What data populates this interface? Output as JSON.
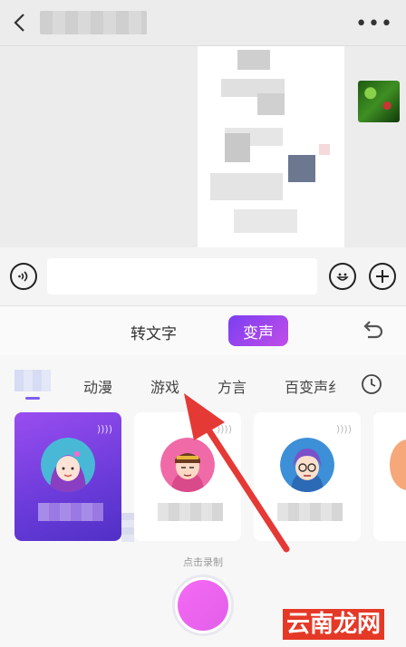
{
  "header": {
    "title": "",
    "more_label": "•••"
  },
  "input": {
    "voice_icon": "voice-icon",
    "placeholder": "",
    "emoji_icon": "emoji-icon",
    "add_icon": "add-icon"
  },
  "mode_tabs": [
    {
      "label": "转文字",
      "active": false
    },
    {
      "label": "变声",
      "active": true
    }
  ],
  "categories": [
    "动漫",
    "游戏",
    "方言",
    "百变声纟"
  ],
  "colors": {
    "accent": "#7b3ff2",
    "record": "#f56bf5",
    "arrow": "#e53935"
  },
  "record": {
    "label": "点击录制"
  },
  "watermark": "云南龙网"
}
